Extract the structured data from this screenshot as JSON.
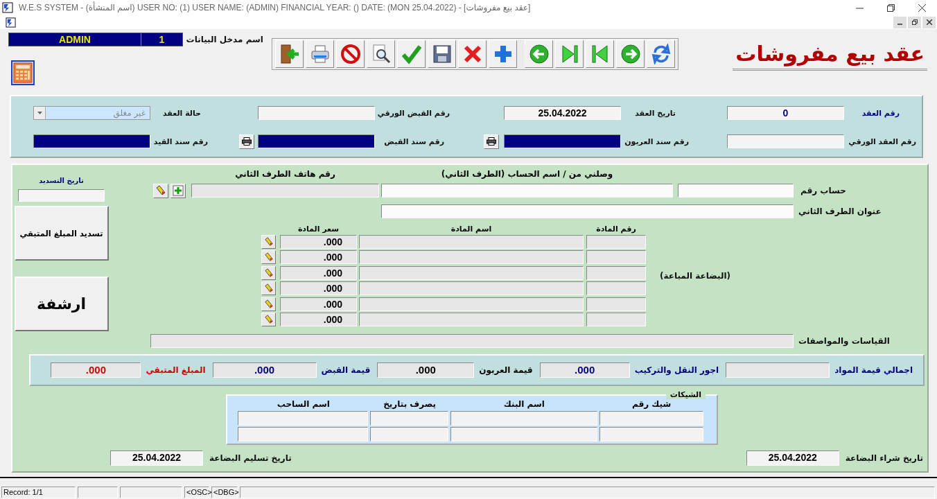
{
  "window": {
    "title": "W.E.S SYSTEM -  (اسم المنشأة)  USER NO: (1) USER NAME: (ADMIN) FINANCIAL YEAR: ()  DATE: (MON 25.04.2022) - [عقد بيع مفروشات]"
  },
  "user_bar": {
    "name": "ADMIN",
    "number": "1",
    "label": "اسم مدخل البيانات"
  },
  "form_title": "عقد بيع مفروشات",
  "contract": {
    "status": {
      "label": "حالة العقد",
      "value": "غير مغلق"
    },
    "paper_receipt_no": {
      "label": "رقم القبض الورقي"
    },
    "contract_date": {
      "label": "تاريخ العقد",
      "value": "25.04.2022"
    },
    "contract_no": {
      "label": "رقم العقد",
      "value": "0"
    },
    "entry_voucher_no": {
      "label": "رقم سند القيد"
    },
    "receipt_voucher_no": {
      "label": "رقم سند القبض"
    },
    "deposit_voucher_no": {
      "label": "رقم سند العربون"
    },
    "paper_contract_no": {
      "label": "رقم العقد الورقي"
    }
  },
  "party": {
    "settlement_date_label": "تاريخ التسديد",
    "phone_label": "رقم هاتف الطرف الثاني",
    "account_name_label": "وصلني من / اسم الحساب (الطرف الثاني)",
    "account_no_label": "حساب رقم",
    "address_label": "عنوان الطرف الثاني"
  },
  "actions": [
    "تسديد المبلغ المتبقي",
    "ارشفة"
  ],
  "goods": {
    "label": "(البضاعة المباعة)",
    "columns": [
      "رقم المادة",
      "اسم المادة",
      "سعر المادة"
    ],
    "rows": [
      {
        "price": ".000"
      },
      {
        "price": ".000"
      },
      {
        "price": ".000"
      },
      {
        "price": ".000"
      },
      {
        "price": ".000"
      },
      {
        "price": ".000"
      }
    ]
  },
  "specs_label": "القياسات والمواصفات",
  "totals": [
    {
      "label": "اجمالي قيمة المواد",
      "color": "#000080"
    },
    {
      "label": "اجور النقل والتركيب",
      "value": ".000",
      "color": "#000080"
    },
    {
      "label": "قيمة العربون",
      "value": ".000",
      "color": "#000000"
    },
    {
      "label": "قيمة القبض",
      "value": ".000",
      "color": "#000080"
    },
    {
      "label": "المبلغ المتبقي",
      "value": ".000",
      "color": "#d00000"
    }
  ],
  "cheques": {
    "title": "الشيكات",
    "columns": [
      "شيك رقم",
      "اسم البنك",
      "يصرف بتاريخ",
      "اسم الساحب"
    ]
  },
  "purchase_date": {
    "label": "تاريخ شراء البضاعة",
    "value": "25.04.2022"
  },
  "delivery_date": {
    "label": "تاريخ تسليم البضاعة",
    "value": "25.04.2022"
  },
  "status_bar": {
    "record": "Record: 1/1",
    "osc": "<OSC>",
    "dbg": "<DBG>"
  }
}
